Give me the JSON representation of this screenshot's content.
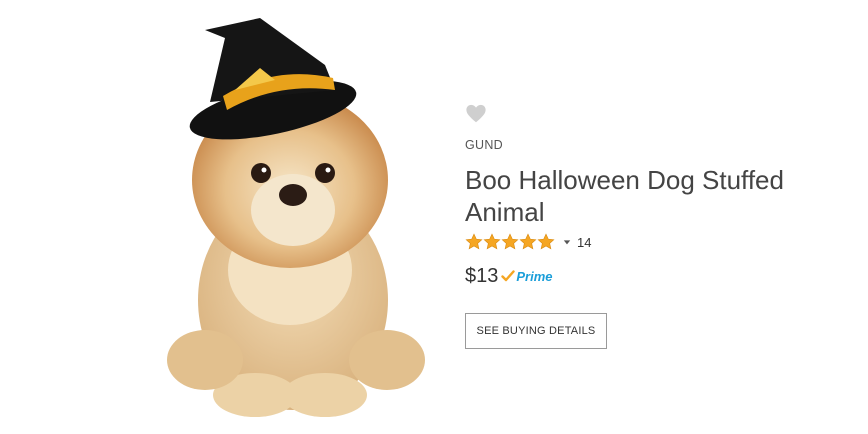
{
  "product": {
    "brand": "GUND",
    "title": "Boo Halloween Dog Stuffed Animal",
    "rating": 5,
    "rating_max": 5,
    "review_count": "14",
    "price": "$13",
    "prime_label": "Prime",
    "button_label": "SEE BUYING DETAILS",
    "image_subject": "plush pomeranian dog wearing black witch hat"
  },
  "icons": {
    "favorite": "heart-icon",
    "rating_dropdown": "caret-down-icon",
    "prime_check": "check-icon"
  },
  "colors": {
    "star": "#f5a623",
    "prime": "#1b9ed9",
    "heart": "#cfcfcf"
  }
}
